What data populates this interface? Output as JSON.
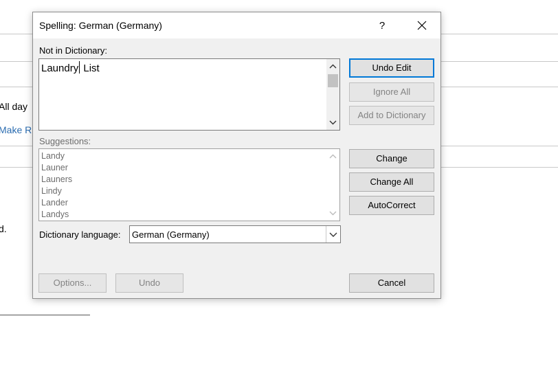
{
  "background": {
    "all_day_text": "All day",
    "make_link_text": "Make R",
    "period_text": "d."
  },
  "dialog": {
    "title": "Spelling: German (Germany)",
    "help_label": "?",
    "not_in_dictionary_label": "Not in Dictionary:",
    "text_before_caret": "Laundry",
    "text_after_caret": " List",
    "suggestions_label": "Suggestions:",
    "suggestions": [
      "Landy",
      "Launer",
      "Launers",
      "Lindy",
      "Lander",
      "Landys"
    ],
    "dictionary_language_label": "Dictionary language:",
    "dictionary_language_value": "German (Germany)",
    "buttons": {
      "undo_edit": "Undo Edit",
      "ignore_all": "Ignore All",
      "add_to_dictionary": "Add to Dictionary",
      "change": "Change",
      "change_all": "Change All",
      "autocorrect": "AutoCorrect",
      "options": "Options...",
      "undo": "Undo",
      "cancel": "Cancel"
    }
  },
  "colors": {
    "dialog_bg": "#f0f0f0",
    "accent": "#0078d7",
    "link": "#2b6cb0"
  }
}
